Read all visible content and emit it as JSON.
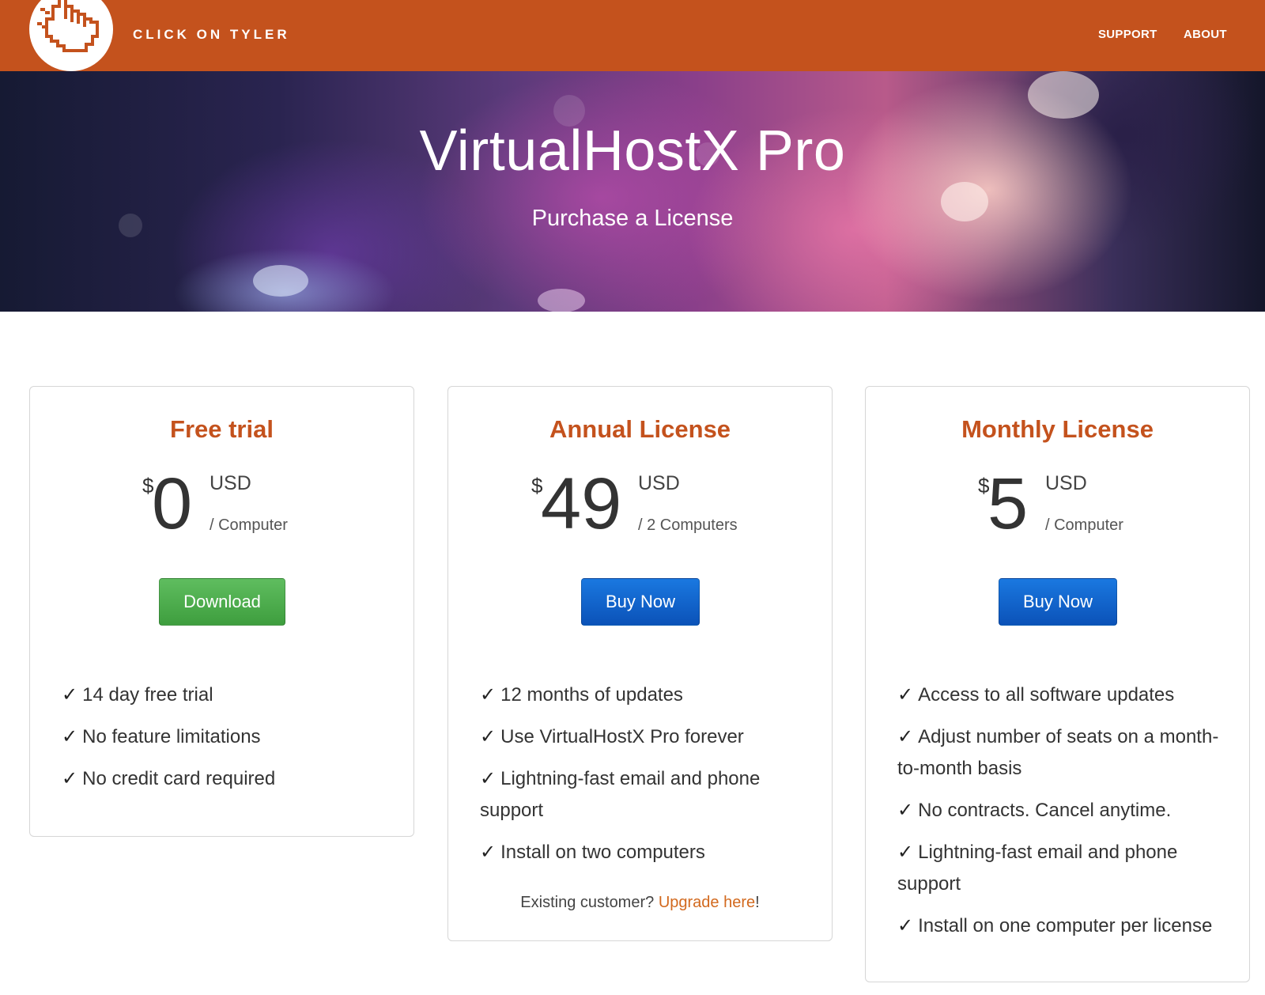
{
  "header": {
    "brand": "CLICK ON TYLER",
    "nav": {
      "support": "SUPPORT",
      "about": "ABOUT"
    },
    "logo_icon": "pointing-hand-cursor-icon",
    "bar_color": "#c4521d"
  },
  "hero": {
    "title": "VirtualHostX Pro",
    "subtitle": "Purchase a License"
  },
  "plans": [
    {
      "title": "Free trial",
      "currency": "$",
      "amount": "0",
      "usd": "USD",
      "unit": "/ Computer",
      "button": "Download",
      "button_color": "#4caf50",
      "features": [
        "14 day free trial",
        "No feature limitations",
        "No credit card required"
      ]
    },
    {
      "title": "Annual License",
      "currency": "$",
      "amount": "49",
      "usd": "USD",
      "unit": "/ 2 Computers",
      "button": "Buy Now",
      "button_color": "#0b62cc",
      "features": [
        "12 months of updates",
        "Use VirtualHostX Pro forever",
        "Lightning-fast email and phone support",
        "Install on two computers"
      ],
      "footer_prefix": "Existing customer? ",
      "footer_link": "Upgrade here",
      "footer_suffix": "!"
    },
    {
      "title": "Monthly License",
      "currency": "$",
      "amount": "5",
      "usd": "USD",
      "unit": "/ Computer",
      "button": "Buy Now",
      "button_color": "#0b62cc",
      "features": [
        "Access to all software updates",
        "Adjust number of seats on a month-to-month basis",
        "No contracts. Cancel anytime.",
        "Lightning-fast email and phone support",
        "Install on one computer per license"
      ]
    }
  ],
  "check_mark": "✓",
  "accent_color": "#c4521d"
}
